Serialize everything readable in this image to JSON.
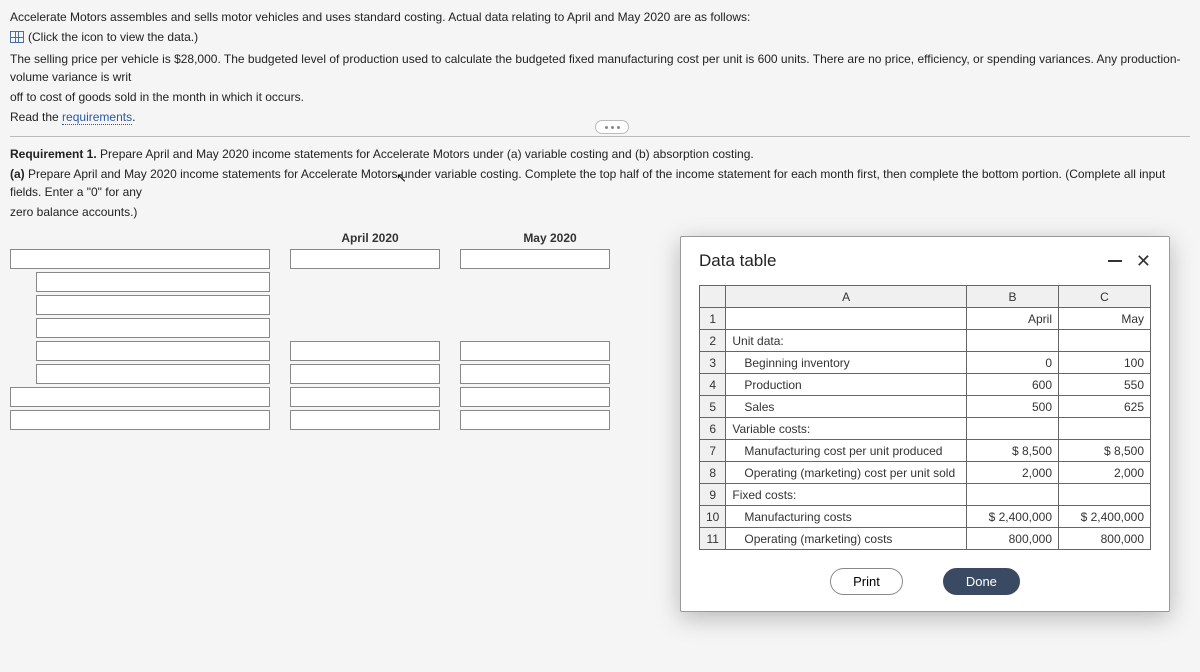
{
  "intro": {
    "line1": "Accelerate Motors assembles and sells motor vehicles and uses standard costing. Actual data relating to April and May 2020 are as follows:",
    "click_icon": "(Click the icon to view the data.)",
    "line2": "The selling price per vehicle is $28,000. The budgeted level of production used to calculate the budgeted fixed manufacturing cost per unit is 600 units. There are no price, efficiency, or spending variances. Any production-volume variance is writ",
    "line3": "off to cost of goods sold in the month in which it occurs.",
    "read_req": "Read the ",
    "requirements_link": "requirements"
  },
  "req": {
    "title_prefix": "Requirement 1.",
    "title_rest": " Prepare April and May 2020 income statements for Accelerate Motors under (a) variable costing and (b) absorption costing.",
    "part_a_prefix": "(a)",
    "part_a_rest": " Prepare April and May 2020 income statements for Accelerate Motors under variable costing. Complete the top half of the income statement for each month first, then complete the bottom portion. (Complete all input fields. Enter a \"0\" for any",
    "part_a_tail": "zero balance accounts.)"
  },
  "columns": {
    "april": "April 2020",
    "may": "May 2020"
  },
  "modal": {
    "title": "Data table",
    "print": "Print",
    "done": "Done",
    "headers": {
      "a": "A",
      "b": "B",
      "c": "C"
    },
    "rows": {
      "r1": {
        "b": "April",
        "c": "May"
      },
      "r2": {
        "a": "Unit data:"
      },
      "r3": {
        "a": "Beginning inventory",
        "b": "0",
        "c": "100"
      },
      "r4": {
        "a": "Production",
        "b": "600",
        "c": "550"
      },
      "r5": {
        "a": "Sales",
        "b": "500",
        "c": "625"
      },
      "r6": {
        "a": "Variable costs:"
      },
      "r7": {
        "a": "Manufacturing cost per unit produced",
        "b": "$        8,500",
        "c": "$        8,500"
      },
      "r8": {
        "a": "Operating (marketing) cost per unit sold",
        "b": "2,000",
        "c": "2,000"
      },
      "r9": {
        "a": "Fixed costs:"
      },
      "r10": {
        "a": "Manufacturing costs",
        "b": "$  2,400,000",
        "c": "$  2,400,000"
      },
      "r11": {
        "a": "Operating (marketing) costs",
        "b": "800,000",
        "c": "800,000"
      }
    }
  }
}
